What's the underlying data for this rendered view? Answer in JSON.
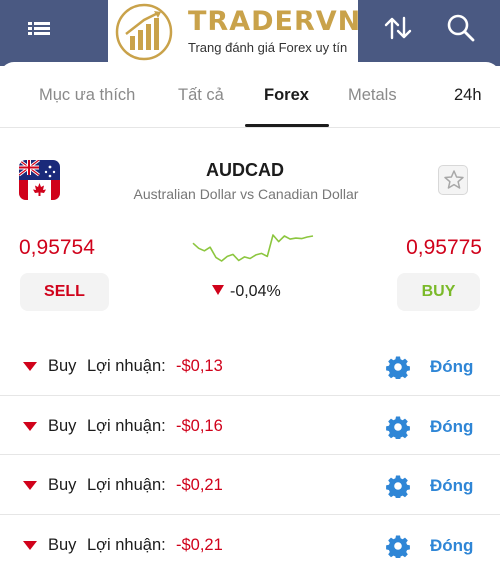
{
  "header": {
    "menu_icon": "hamburger-menu-icon",
    "sort_icon": "sort-arrows-icon",
    "search_icon": "search-icon",
    "background": "#4a5982"
  },
  "watermark": {
    "title": "TRADERVN",
    "subtitle": "Trang đánh giá Forex uy tín"
  },
  "tabs": [
    {
      "label": "Mục ưa thích",
      "active": false
    },
    {
      "label": "Tất cả",
      "active": false
    },
    {
      "label": "Forex",
      "active": true
    },
    {
      "label": "Metals",
      "active": false
    },
    {
      "label": "24h",
      "active": false
    }
  ],
  "instrument": {
    "symbol": "AUDCAD",
    "name": "Australian Dollar vs Canadian Dollar",
    "flag_icon": "aud-cad-flag-icon",
    "favorite_icon": "star-outline-icon",
    "sell_price": "0,95754",
    "buy_price": "0,95775",
    "sell_label": "SELL",
    "buy_label": "BUY",
    "change": "-0,04%",
    "change_direction": "down",
    "sparkline": [
      5,
      4,
      3.5,
      4.2,
      2.2,
      1.5,
      2.4,
      2.8,
      1.6,
      2.3,
      2.0,
      2.7,
      3.0,
      2.4,
      6.6,
      5.3,
      6.4,
      5.8,
      6.0,
      5.9,
      6.2,
      6.4
    ],
    "colors": {
      "price": "#d0021b",
      "buy": "#7ab929",
      "sparkline": "#8cc63f"
    }
  },
  "positions": [
    {
      "side": "Buy",
      "profit_label": "Lợi nhuận:",
      "profit": "-$0,13",
      "close_label": "Đóng"
    },
    {
      "side": "Buy",
      "profit_label": "Lợi nhuận:",
      "profit": "-$0,16",
      "close_label": "Đóng"
    },
    {
      "side": "Buy",
      "profit_label": "Lợi nhuận:",
      "profit": "-$0,21",
      "close_label": "Đóng"
    },
    {
      "side": "Buy",
      "profit_label": "Lợi nhuận:",
      "profit": "-$0,21",
      "close_label": "Đóng"
    }
  ],
  "position_icons": {
    "expand": "caret-down-icon",
    "settings": "gear-icon"
  },
  "accent_colors": {
    "negative": "#d0021b",
    "link": "#2f86d6"
  }
}
